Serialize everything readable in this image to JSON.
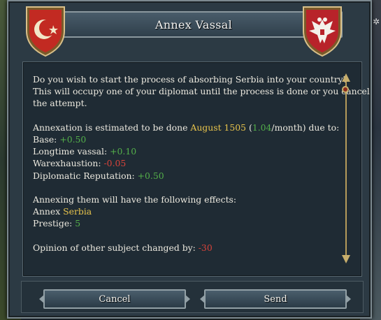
{
  "dialog": {
    "title": "Annex Vassal",
    "icons": {
      "left_shield": "ottoman-crescent-shield-icon",
      "right_shield": "serbian-eagle-shield-icon"
    },
    "text": {
      "question_line1": "Do you wish to start the process of absorbing Serbia into your country?",
      "question_line2": "This will occupy one of your diplomat until the process is done or you cancel",
      "question_line3": "the attempt.",
      "estimate_prefix": "Annexation is estimated to be done ",
      "estimate_date": "August 1505",
      "estimate_paren_open": " (",
      "estimate_rate": "1.04",
      "estimate_suffix": "/month) due to:",
      "base_label": "Base: ",
      "base_value": "+0.50",
      "longtime_label": "Longtime vassal: ",
      "longtime_value": "+0.10",
      "war_label": "Warexhaustion: ",
      "war_value": "-0.05",
      "diprep_label": "Diplomatic Reputation: ",
      "diprep_value": "+0.50",
      "effects_heading": "Annexing them will have the following effects:",
      "annex_label": "Annex ",
      "annex_target": "Serbia",
      "prestige_label": "Prestige: ",
      "prestige_value": "5",
      "opinion_label": "Opinion of other subject changed by: ",
      "opinion_value": "-30"
    },
    "buttons": {
      "cancel": "Cancel",
      "send": "Send"
    },
    "colors": {
      "highlight_yellow": "#e8c44c",
      "positive_green": "#54b04a",
      "negative_red": "#d9433a"
    }
  }
}
